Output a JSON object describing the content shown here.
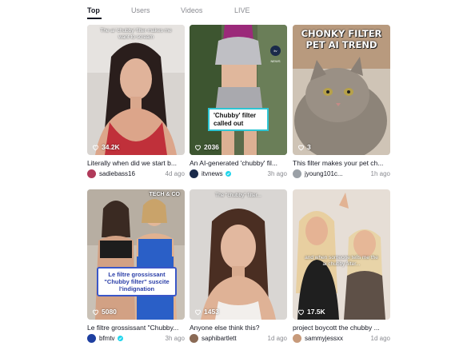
{
  "tabs": [
    {
      "label": "Top",
      "active": true
    },
    {
      "label": "Users",
      "active": false
    },
    {
      "label": "Videos",
      "active": false
    },
    {
      "label": "LIVE",
      "active": false
    }
  ],
  "videos": [
    {
      "caption_overlay": "The ai 'chubby' filter makes me want to scream",
      "likes": "34.2K",
      "description": "Literally when did we start b...",
      "author": "sadiebass16",
      "verified": false,
      "time": "4d ago",
      "avatar_color": "#b03a5a"
    },
    {
      "caption_overlay": "'Chubby' filter called out",
      "badge": "itv NEWS",
      "likes": "2036",
      "description": "An AI-generated 'chubby' fil...",
      "author": "itvnews",
      "verified": true,
      "time": "3h ago",
      "avatar_color": "#1a2a4a"
    },
    {
      "caption_overlay": "CHONKY FILTER PET AI TREND",
      "likes": "3",
      "description": "This filter makes your pet ch...",
      "author": "jyoung101c...",
      "verified": false,
      "time": "1h ago",
      "avatar_color": "#9aa0a6"
    },
    {
      "caption_overlay": "Le filtre grossissant \"Chubby filter\" suscite l'indignation",
      "badge": "TECH & CO",
      "likes": "5080",
      "description": "Le filtre grossissant \"Chubby...",
      "author": "bfmtv",
      "verified": true,
      "time": "3h ago",
      "avatar_color": "#1e3fa0"
    },
    {
      "caption_overlay": "The \"chubby\" filter...",
      "likes": "1453",
      "description": "Anyone else think this?",
      "author": "saphibartlett",
      "verified": false,
      "time": "1d ago",
      "avatar_color": "#8a6a55"
    },
    {
      "caption_overlay": "and when someone tells me the ai chubby filter...",
      "likes": "17.5K",
      "description": "project boycott the chubby ...",
      "author": "sammyjessxx",
      "verified": false,
      "time": "1d ago",
      "avatar_color": "#c79a7a"
    }
  ],
  "colors": {
    "tab_inactive": "#8a8b91",
    "text": "#161823",
    "verified": "#20d5ec",
    "news_border": "#2ec5d3",
    "french_box_border": "#3a57c8"
  },
  "icons": [
    "heart-outline-icon",
    "verified-check-icon"
  ]
}
